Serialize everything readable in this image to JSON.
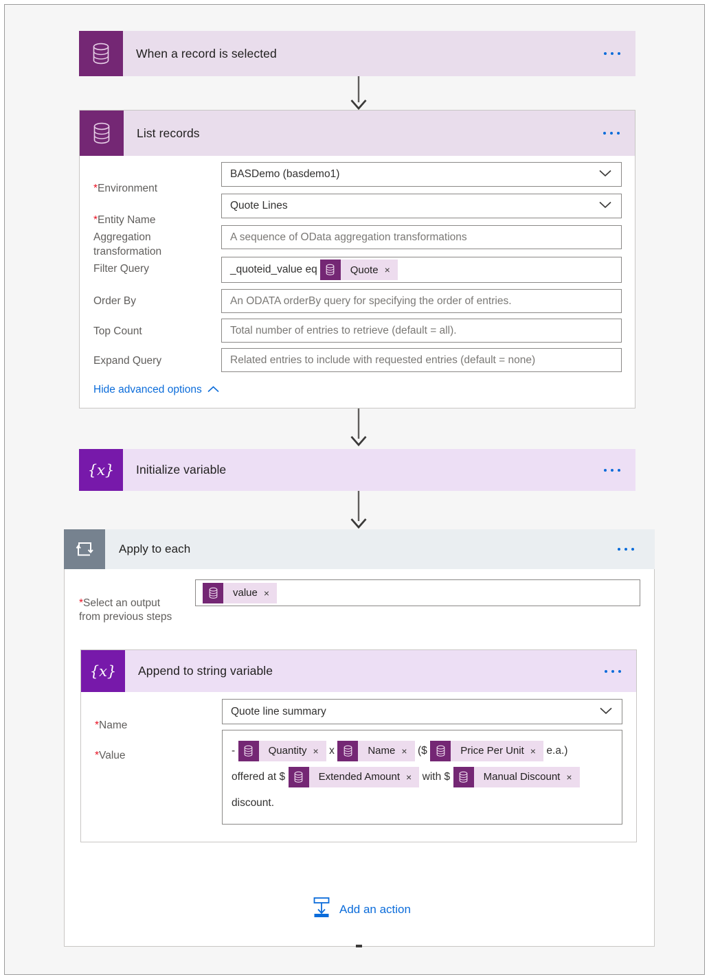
{
  "theme": {
    "canvas_bg": "#f6f6f6",
    "page_border": "#9a9a9a",
    "dataverse_purple": "#742774",
    "variable_violet": "#7719aa",
    "loop_slate": "#76828f",
    "trigger_strip": "#e9ddec",
    "variable_strip": "#eddff5",
    "loop_strip": "#eaeef1",
    "link_blue": "#0b6cda",
    "required_red": "#e81123",
    "token_bg": "#eddcee"
  },
  "flow": {
    "trigger": {
      "title": "When a record is selected",
      "icon": "dataverse-database-icon",
      "menu": "more-commands-ellipsis"
    },
    "list_records": {
      "title": "List records",
      "icon": "dataverse-database-icon",
      "menu": "more-commands-ellipsis",
      "fields": [
        {
          "label": "Environment",
          "required": true,
          "type": "dropdown",
          "value": "BASDemo (basdemo1)",
          "placeholder": ""
        },
        {
          "label": "Entity Name",
          "required": true,
          "type": "dropdown",
          "value": "Quote Lines",
          "placeholder": ""
        },
        {
          "label": "Aggregation transformation",
          "required": false,
          "type": "text",
          "value": "",
          "placeholder": "A sequence of OData aggregation transformations"
        },
        {
          "label": "Filter Query",
          "required": false,
          "type": "token-text",
          "value": "",
          "placeholder": ""
        },
        {
          "label": "Order By",
          "required": false,
          "type": "text",
          "value": "",
          "placeholder": "An ODATA orderBy query for specifying the order of entries."
        },
        {
          "label": "Top Count",
          "required": false,
          "type": "text",
          "value": "",
          "placeholder": "Total number of entries to retrieve (default = all)."
        },
        {
          "label": "Expand Query",
          "required": false,
          "type": "text",
          "value": "",
          "placeholder": "Related entries to include with requested entries (default = none)"
        }
      ],
      "filter_query": {
        "prefix": "_quoteid_value eq",
        "token": {
          "label": "Quote",
          "icon": "dataverse-database-icon",
          "remove": "×"
        }
      },
      "advanced_toggle": {
        "label": "Hide advanced options",
        "icon": "chevron-up-icon"
      }
    },
    "initialize_variable": {
      "title": "Initialize variable",
      "icon": "variable-braces-icon",
      "menu": "more-commands-ellipsis"
    },
    "apply_to_each": {
      "title": "Apply to each",
      "icon": "loop-repeat-icon",
      "menu": "more-commands-ellipsis",
      "output_field": {
        "label": "Select an output\nfrom previous steps",
        "required": true,
        "token": {
          "label": "value",
          "icon": "dataverse-database-icon",
          "remove": "×"
        }
      },
      "append_action": {
        "title": "Append to string variable",
        "icon": "variable-braces-icon",
        "menu": "more-commands-ellipsis",
        "name_field": {
          "label": "Name",
          "required": true,
          "type": "dropdown",
          "value": "Quote line summary"
        },
        "value_field": {
          "label": "Value",
          "required": true,
          "lines": [
            [
              {
                "kind": "text",
                "text": "-"
              },
              {
                "kind": "token",
                "label": "Quantity",
                "icon": "dataverse-database-icon",
                "remove": "×"
              },
              {
                "kind": "text",
                "text": "x"
              },
              {
                "kind": "token",
                "label": "Name",
                "icon": "dataverse-database-icon",
                "remove": "×"
              },
              {
                "kind": "text",
                "text": "($"
              },
              {
                "kind": "token",
                "label": "Price Per Unit",
                "icon": "dataverse-database-icon",
                "remove": "×"
              },
              {
                "kind": "text",
                "text": "e.a.)"
              }
            ],
            [
              {
                "kind": "text",
                "text": "offered at $"
              },
              {
                "kind": "token",
                "label": "Extended Amount",
                "icon": "dataverse-database-icon",
                "remove": "×"
              },
              {
                "kind": "text",
                "text": "with $"
              },
              {
                "kind": "token",
                "label": "Manual Discount",
                "icon": "dataverse-database-icon",
                "remove": "×"
              }
            ],
            [
              {
                "kind": "text",
                "text": "discount."
              }
            ]
          ]
        }
      },
      "add_action": {
        "label": "Add an action",
        "icon": "insert-action-icon"
      }
    }
  }
}
